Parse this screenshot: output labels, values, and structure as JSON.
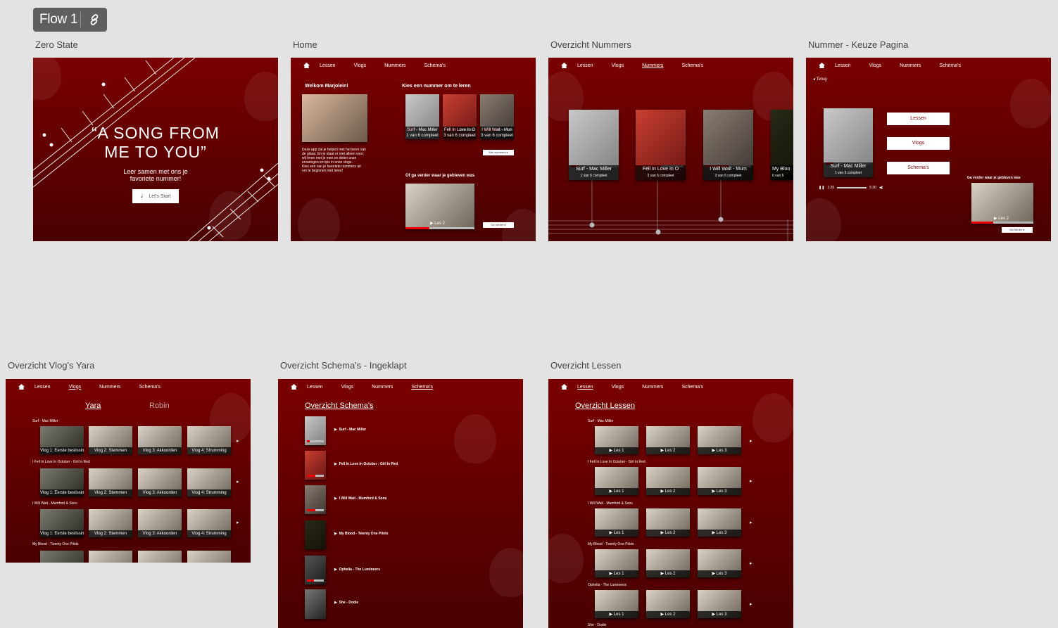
{
  "flow": {
    "label": "Flow 1"
  },
  "screens": {
    "zero": {
      "title": "Zero State",
      "quote_line1": "“A SONG FROM",
      "quote_line2": "ME TO YOU”",
      "tagline_line1": "Leer samen met ons je",
      "tagline_line2": "favoriete nummer!",
      "start": "Let's Start"
    },
    "home": {
      "title": "Home",
      "nav": [
        "Lessen",
        "Vlogs",
        "Nummers",
        "Schema's"
      ],
      "welcome": "Welkom Marjolein!",
      "pick": "Kies een nummer om te leren",
      "intro": [
        "Deze app zal je helpen met het leren van",
        "de gitaar. En je staat er niet alleen voor:",
        "wij leren met je mee en delen onze",
        "ervaringen en tips in onze vlogs.",
        "Kies een van je favoriete nummers uit",
        "om te beginnen met leren!"
      ],
      "songs": [
        {
          "cap": "Surf - Mac Miller",
          "sub": "1 van 6 compleet"
        },
        {
          "cap": "Fell In Love In O",
          "sub": "3 van 6 compleet"
        },
        {
          "cap": "I Will Wait - Mun",
          "sub": "3 van 6 compleet"
        }
      ],
      "all": "Alle nummers",
      "continue_title": "Of ga verder waar je gebleven was",
      "lesson": "Les 2",
      "go_on": "Ga Verder"
    },
    "nummers": {
      "title": "Overzicht Nummers",
      "nav": [
        "Lessen",
        "Vlogs",
        "Nummers",
        "Schema's"
      ],
      "cards": [
        {
          "cap": "Surf - Mac Miller",
          "sub": "1 van 6 compleet"
        },
        {
          "cap": "Fell In Love In O",
          "sub": "3 van 6 compleet"
        },
        {
          "cap": "I Will Wait - Mum",
          "sub": "3 van 6 compleet"
        },
        {
          "cap": "My Bloo",
          "sub": "0 van 6"
        }
      ]
    },
    "keuze": {
      "title": "Nummer - Keuze Pagina",
      "nav": [
        "Lessen",
        "Vlogs",
        "Nummers",
        "Schema's"
      ],
      "back": "Terug",
      "song": "Surf - Mac Miller",
      "sub": "1 van 6 compleet",
      "buttons": [
        "Lessen",
        "Vlogs",
        "Schema's"
      ],
      "t_start": "1:20",
      "t_end": "5:30",
      "continue_title": "Ga verder waar je gebleven was",
      "lesson": "Les 2",
      "go_on": "Ga Verder"
    },
    "vlogs": {
      "title": "Overzicht Vlog's Yara",
      "nav": [
        "Lessen",
        "Vlogs",
        "Nummers",
        "Schema's"
      ],
      "tab_a": "Yara",
      "tab_b": "Robin",
      "rows": [
        "Surf - Mac Miller",
        "I Fell In Love In October - Girl In Red",
        "I Will Wait - Mumford & Sons",
        "My Blood - Twenty One Pilots"
      ],
      "vids": [
        "Vlog 1: Eerste beslissing",
        "Vlog 2: Stemmen",
        "Vlog 3: Akkoorden",
        "Vlog 4: Strumming"
      ]
    },
    "schema": {
      "title": "Overzicht Schema's - Ingeklapt",
      "nav": [
        "Lessen",
        "Vlogs",
        "Nummers",
        "Schema's"
      ],
      "heading": "Overzicht Schema's",
      "items": [
        "Surf - Mac Miller",
        "Fell In Love In October - Girl In Red",
        "I Will Wait - Mumford & Sons",
        "My Blood - Twenty One Pilots",
        "Ophelia - The Lumineers",
        "She - Dodie"
      ]
    },
    "lessen": {
      "title": "Overzicht Lessen",
      "nav": [
        "Lessen",
        "Vlogs",
        "Nummers",
        "Schema's"
      ],
      "heading": "Overzicht Lessen",
      "rows": [
        "Surf - Mac Miller",
        "I Fell In Love In October - Girl In Red",
        "I Will Wait - Mumford & Sons",
        "My Blood - Twenty One Pilots",
        "Ophelia - The Lumineers",
        "She - Dodie"
      ],
      "lessons": [
        "Les 1",
        "Les 2",
        "Les 3"
      ]
    }
  },
  "colors": {
    "bg": "#e3e3e3",
    "screen": "#6a0000",
    "accent": "#e00000"
  }
}
